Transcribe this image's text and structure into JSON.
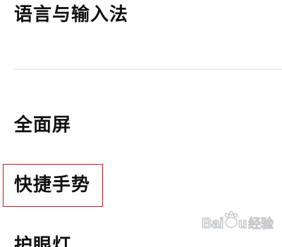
{
  "settings_list": {
    "items": [
      {
        "label": "语言与输入法"
      },
      {
        "label": "全面屏"
      },
      {
        "label": "快捷手势"
      },
      {
        "label": "护眼灯"
      }
    ]
  },
  "annotation": {
    "highlight_color": "#d0121b"
  },
  "watermark": {
    "text": "Baidu经验"
  }
}
